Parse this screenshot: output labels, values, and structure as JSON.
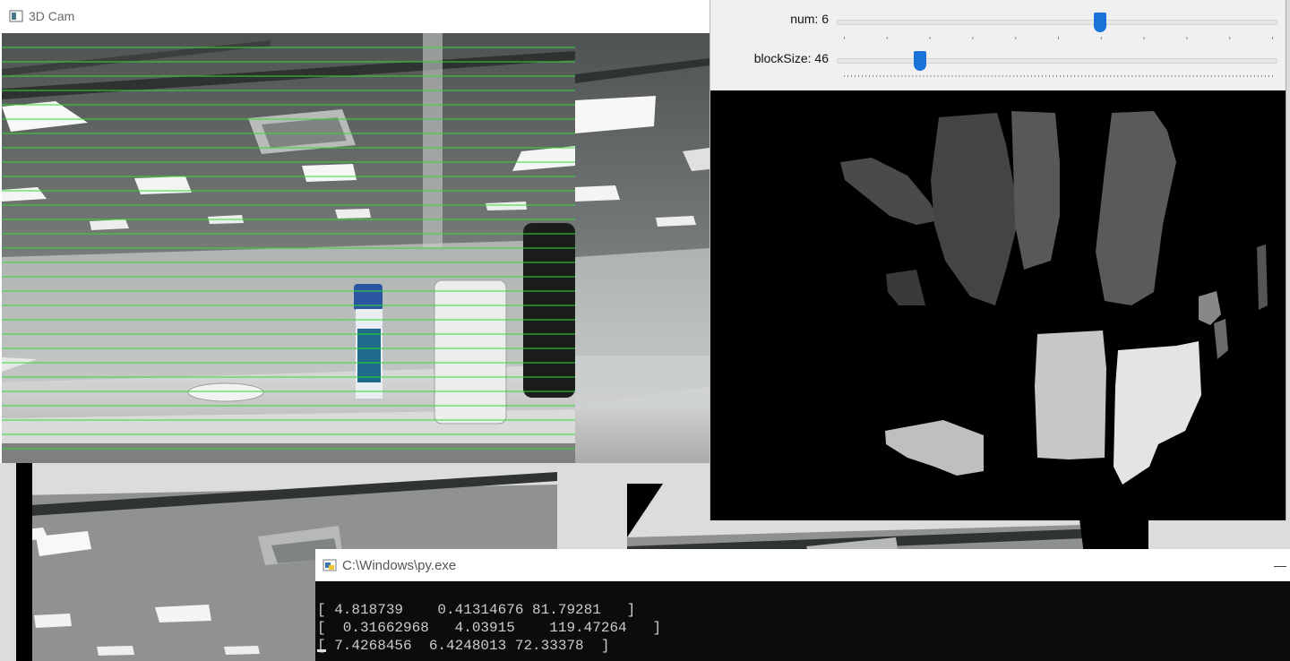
{
  "cam_window": {
    "title": "3D Cam",
    "icon": "window-app-icon"
  },
  "trackbars": [
    {
      "label": "num: 6",
      "value": 6,
      "position": 0.6
    },
    {
      "label": "blockSize: 46",
      "value": 46,
      "position": 0.19
    }
  ],
  "console": {
    "title": "C:\\Windows\\py.exe",
    "icon": "python-launcher-icon",
    "lines": [
      "[ 4.818739    0.41314676 81.79281   ]",
      "[  0.31662968   4.03915    119.47264   ]",
      "[ 7.4268456  6.4248013 72.33378  ]"
    ]
  },
  "colors": {
    "epipolar_lines": "#32dc32",
    "slider_thumb": "#1a73d9",
    "console_bg": "#0c0c0c",
    "console_text": "#cccccc"
  }
}
